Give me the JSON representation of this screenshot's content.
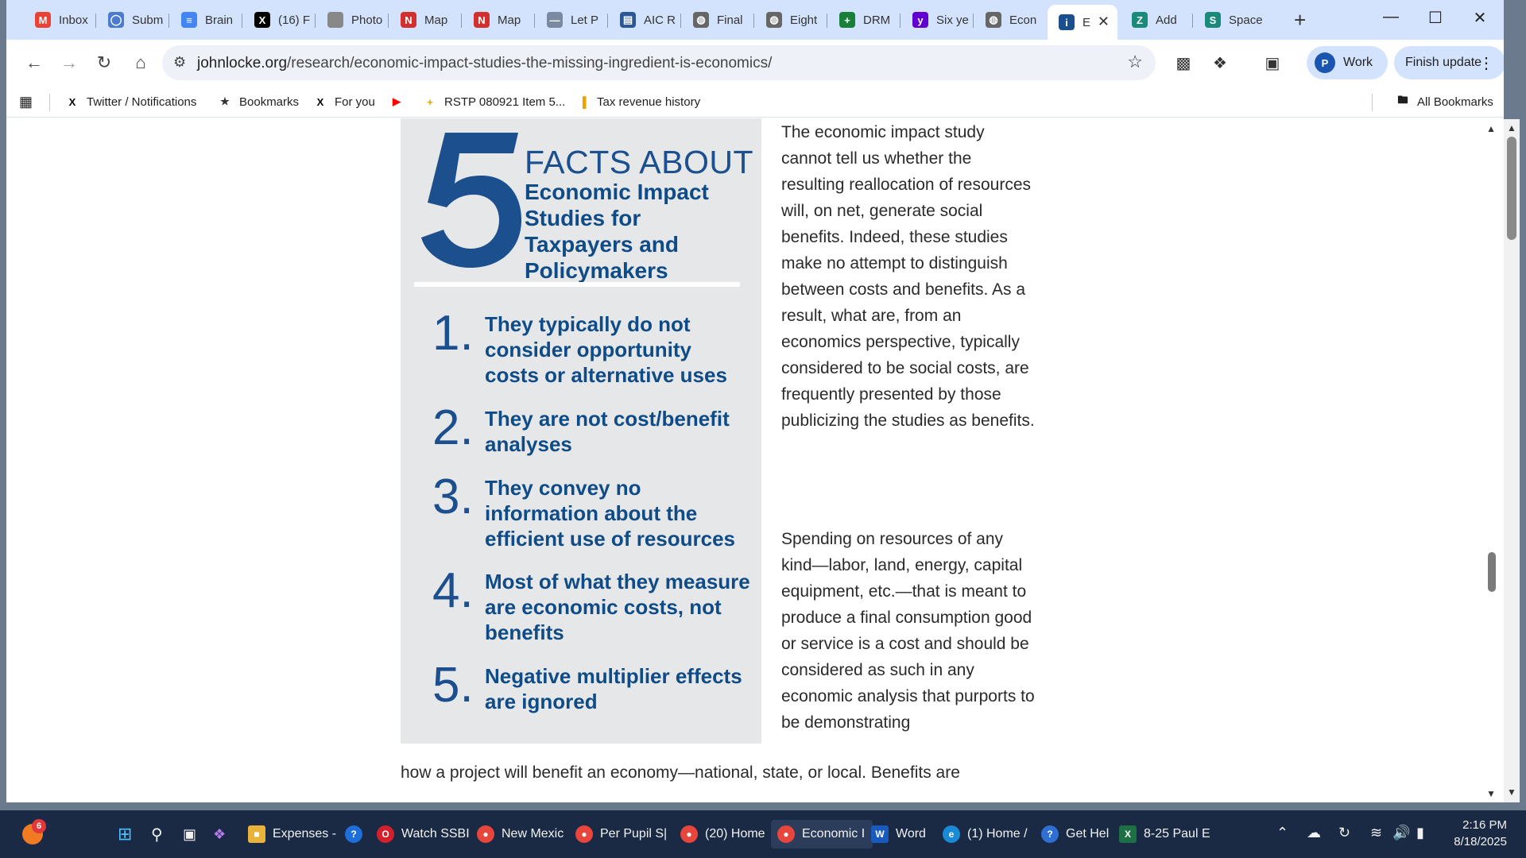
{
  "tabs": [
    {
      "label": "Inbox",
      "icon": "gmail-icon",
      "color": "#ea4335",
      "glyph": "M"
    },
    {
      "label": "Subm",
      "icon": "circle-icon",
      "color": "#4a7bd0",
      "glyph": "◯"
    },
    {
      "label": "Brain",
      "icon": "docs-icon",
      "color": "#4285f4",
      "glyph": "≡"
    },
    {
      "label": "(16) F",
      "icon": "x-icon",
      "color": "#000000",
      "glyph": "X"
    },
    {
      "label": "Photo",
      "icon": "apple-icon",
      "color": "#888888",
      "glyph": ""
    },
    {
      "label": "Map",
      "icon": "n-icon",
      "color": "#d32f2f",
      "glyph": "N"
    },
    {
      "label": "Map",
      "icon": "n-icon",
      "color": "#d32f2f",
      "glyph": "N"
    },
    {
      "label": "Let P",
      "icon": "dash-icon",
      "color": "#7a8aa0",
      "glyph": "—"
    },
    {
      "label": "AIC R",
      "icon": "chart-icon",
      "color": "#2b5797",
      "glyph": "▤"
    },
    {
      "label": "Final",
      "icon": "globe-icon",
      "color": "#666666",
      "glyph": "◍"
    },
    {
      "label": "Eight",
      "icon": "globe-icon",
      "color": "#666666",
      "glyph": "◍"
    },
    {
      "label": "DRM",
      "icon": "plus-icon",
      "color": "#188038",
      "glyph": "+"
    },
    {
      "label": "Six ye",
      "icon": "yahoo-icon",
      "color": "#6001d2",
      "glyph": "y"
    },
    {
      "label": "Econ",
      "icon": "globe-icon",
      "color": "#666666",
      "glyph": "◍"
    },
    {
      "label": "E",
      "icon": "jla-icon",
      "color": "#1b4f8d",
      "glyph": "i",
      "active": true
    },
    {
      "label": "Add",
      "icon": "z-icon",
      "color": "#1a8a7a",
      "glyph": "Z"
    },
    {
      "label": "Space",
      "icon": "sheet-icon",
      "color": "#1a8a7a",
      "glyph": "S"
    }
  ],
  "url": {
    "host": "johnlocke.org",
    "path": "/research/economic-impact-studies-the-missing-ingredient-is-economics/"
  },
  "profile": {
    "initial": "P",
    "label": "Work"
  },
  "finish_update": "Finish update",
  "bookmarks": [
    {
      "label": "Twitter / Notifications",
      "icon": "x-icon"
    },
    {
      "label": "Bookmarks",
      "icon": "star-icon"
    },
    {
      "label": "For you",
      "icon": "x-icon"
    },
    {
      "label": "",
      "icon": "youtube-icon"
    },
    {
      "label": "RSTP 080921 Item 5...",
      "icon": "plus-box-icon"
    },
    {
      "label": "Tax revenue history",
      "icon": "bar-chart-icon"
    }
  ],
  "all_bookmarks": "All Bookmarks",
  "infographic": {
    "number": "5",
    "title": "FACTS ABOUT",
    "subtitle": "Economic Impact Studies for Taxpayers and Policymakers",
    "facts": [
      {
        "num": "1.",
        "text": "They typically do not consider opportunity costs or alternative uses"
      },
      {
        "num": "2.",
        "text": "They are not cost/benefit analyses"
      },
      {
        "num": "3.",
        "text": "They convey no information about the efficient use of resources"
      },
      {
        "num": "4.",
        "text": "Most of what they measure are economic costs, not benefits"
      },
      {
        "num": "5.",
        "text": "Negative multiplier effects are ignored"
      }
    ]
  },
  "article": {
    "para1": "The economic impact study cannot tell us whether the resulting reallocation of resources will, on net, generate social benefits. Indeed, these studies make no attempt to distinguish between costs and benefits. As a result, what are, from an economics perspective, typically considered to be social costs, are frequently presented by those publicizing the studies as benefits.",
    "para2": "Spending on resources of any kind—labor, land, energy, capital equipment, etc.—that is meant to produce a final consumption good or service is a cost and should be considered as such in any economic analysis that purports to be demonstrating",
    "tail": "how a project will benefit an economy—national, state, or local. Benefits are"
  },
  "taskbar": {
    "badge": "6",
    "apps": [
      {
        "label": "Expenses -",
        "icon": "folder-icon",
        "color": "#e8b33a"
      },
      {
        "label": "",
        "icon": "help-icon",
        "color": "#1e6fd9"
      },
      {
        "label": "Watch SSBI",
        "icon": "opera-icon",
        "color": "#d4202b"
      },
      {
        "label": "New Mexic",
        "icon": "chrome-icon",
        "color": "#e8453c"
      },
      {
        "label": "Per Pupil S|",
        "icon": "chrome-icon",
        "color": "#e8453c"
      },
      {
        "label": "(20) Home",
        "icon": "chrome-icon",
        "color": "#e8453c"
      },
      {
        "label": "Economic I",
        "icon": "chrome-icon",
        "color": "#e8453c",
        "active": true
      },
      {
        "label": "Word",
        "icon": "word-icon",
        "color": "#185abd"
      },
      {
        "label": "(1) Home /",
        "icon": "edge-icon",
        "color": "#1b8ad4"
      },
      {
        "label": "Get Hel",
        "icon": "gethelp-icon",
        "color": "#2f6fd4"
      },
      {
        "label": "8-25 Paul E",
        "icon": "excel-icon",
        "color": "#1d7044"
      }
    ],
    "time": "2:16 PM",
    "date": "8/18/2025"
  }
}
